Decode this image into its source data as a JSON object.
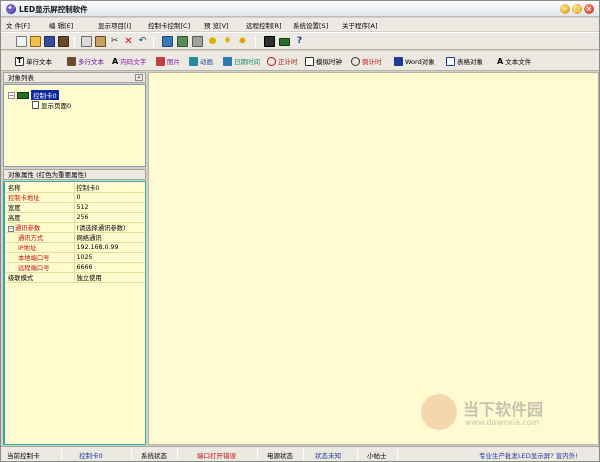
{
  "window": {
    "title": "LED显示屏控制软件"
  },
  "menu": [
    "文 件[F]",
    "编 辑[E]",
    "显示项目[I]",
    "控制卡控制[C]",
    "预 览[V]",
    "远程控制[R]",
    "系统设置[S]",
    "关于程序[A]"
  ],
  "toolbar_icons": [
    "new-icon",
    "open-icon",
    "save-icon",
    "exit-icon",
    "copy-icon",
    "paste-icon",
    "cut-icon",
    "delete-icon",
    "undo-icon",
    "preview-icon",
    "settings-icon",
    "light-icon",
    "bulb-icon",
    "sun-icon",
    "screen-icon",
    "card-icon",
    "help-icon"
  ],
  "toolbar2": [
    "单行文本",
    "多行文本",
    "内码文字",
    "图片",
    "动画",
    "日期时间",
    "正计时",
    "模拟时钟",
    "倒计时",
    "Word对象",
    "表格对象",
    "文本文件"
  ],
  "object_list": {
    "header": "对象列表",
    "root": "控制卡0",
    "child": "显示页面0"
  },
  "properties": {
    "header": "对象属性 (红色为重要属性)",
    "rows": [
      {
        "key": "名称",
        "value": "控制卡0"
      },
      {
        "key": "控制卡地址",
        "value": "0"
      },
      {
        "key": "宽度",
        "value": "512"
      },
      {
        "key": "高度",
        "value": "256"
      },
      {
        "key": "通讯参数",
        "value": "(请选择通讯参数)"
      },
      {
        "key": "通讯方式",
        "value": "网络通讯"
      },
      {
        "key": "IP地址",
        "value": "192.168.0.99"
      },
      {
        "key": "本地端口号",
        "value": "1025"
      },
      {
        "key": "远程端口号",
        "value": "6666"
      },
      {
        "key": "级联模式",
        "value": "独立使用"
      }
    ]
  },
  "status": {
    "label_card": "当前控制卡",
    "card": "控制卡0",
    "label_sys": "系统状态",
    "sys": "端口打开错误",
    "label_power": "电源状态",
    "power": "状态未知",
    "tip": "小帖士",
    "promo": "专业生产批发LED显示屏? 宣内外!"
  },
  "watermark": {
    "text": "当下软件园",
    "url": "www.downxia.com"
  },
  "colors": {
    "canvas": "#fffbd0",
    "accent": "#0a2a9c",
    "error": "#c01010"
  }
}
